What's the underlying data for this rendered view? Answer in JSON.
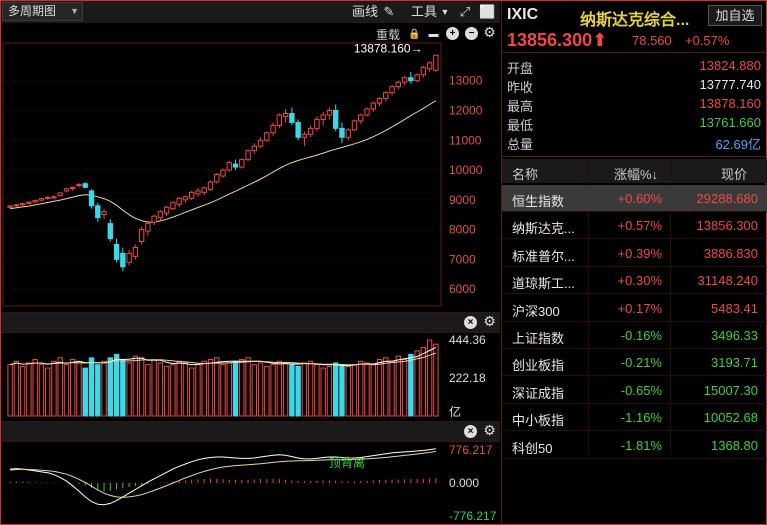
{
  "toolbar": {
    "period_label": "多周期图",
    "draw_label": "画线",
    "tools_label": "工具",
    "reload_label": "重载"
  },
  "chart": {
    "high_annotation": "13878.160",
    "price_axis": [
      "13000",
      "12000",
      "11000",
      "10000",
      "9000",
      "8000",
      "7000",
      "6000"
    ],
    "volume_axis": [
      "444.36",
      "222.18",
      "亿"
    ],
    "macd_axis": [
      "776.217",
      "0.000",
      "-776.217"
    ],
    "macd_annotation": "顶背离"
  },
  "chart_data": {
    "type": "candlestick",
    "price_ylim": [
      5500,
      14200
    ],
    "candles": [
      [
        8750,
        8820,
        8700,
        8790
      ],
      [
        8800,
        8850,
        8760,
        8830
      ],
      [
        8830,
        8900,
        8800,
        8870
      ],
      [
        8880,
        8950,
        8840,
        8920
      ],
      [
        8930,
        9000,
        8900,
        8980
      ],
      [
        8990,
        9060,
        8950,
        9040
      ],
      [
        9050,
        9120,
        9010,
        9080
      ],
      [
        9090,
        9150,
        9030,
        9100
      ],
      [
        9150,
        9250,
        9100,
        9230
      ],
      [
        9300,
        9400,
        9250,
        9370
      ],
      [
        9380,
        9450,
        9300,
        9420
      ],
      [
        9480,
        9560,
        9420,
        9510
      ],
      [
        9540,
        9600,
        9380,
        9420
      ],
      [
        9300,
        9350,
        8700,
        8800
      ],
      [
        8800,
        8900,
        8250,
        8400
      ],
      [
        8500,
        8700,
        8350,
        8600
      ],
      [
        8200,
        8350,
        7600,
        7700
      ],
      [
        7500,
        7700,
        6900,
        7000
      ],
      [
        7200,
        7400,
        6600,
        6750
      ],
      [
        6900,
        7300,
        6800,
        7200
      ],
      [
        7100,
        7500,
        7000,
        7400
      ],
      [
        7600,
        8100,
        7500,
        8000
      ],
      [
        7950,
        8300,
        7800,
        8200
      ],
      [
        8250,
        8500,
        8150,
        8450
      ],
      [
        8400,
        8650,
        8300,
        8600
      ],
      [
        8550,
        8800,
        8450,
        8750
      ],
      [
        8700,
        8950,
        8650,
        8900
      ],
      [
        8850,
        9100,
        8750,
        9050
      ],
      [
        9000,
        9150,
        8900,
        9100
      ],
      [
        9050,
        9300,
        9000,
        9250
      ],
      [
        9200,
        9400,
        9100,
        9300
      ],
      [
        9250,
        9450,
        9150,
        9400
      ],
      [
        9350,
        9650,
        9300,
        9600
      ],
      [
        9600,
        9900,
        9550,
        9850
      ],
      [
        9800,
        10050,
        9750,
        10000
      ],
      [
        10000,
        10300,
        9950,
        10250
      ],
      [
        10200,
        10350,
        10000,
        10100
      ],
      [
        10100,
        10400,
        10050,
        10350
      ],
      [
        10350,
        10700,
        10300,
        10650
      ],
      [
        10650,
        10900,
        10550,
        10800
      ],
      [
        10800,
        11100,
        10750,
        11000
      ],
      [
        11000,
        11300,
        10950,
        11250
      ],
      [
        11250,
        11600,
        11150,
        11500
      ],
      [
        11500,
        11900,
        11400,
        11850
      ],
      [
        11800,
        12050,
        11600,
        11900
      ],
      [
        11900,
        12100,
        11500,
        11600
      ],
      [
        11600,
        11700,
        11000,
        11100
      ],
      [
        11100,
        11300,
        10800,
        11200
      ],
      [
        11200,
        11500,
        11100,
        11400
      ],
      [
        11400,
        11800,
        11300,
        11700
      ],
      [
        11700,
        11950,
        11500,
        11850
      ],
      [
        11850,
        12100,
        11700,
        12000
      ],
      [
        12000,
        12200,
        11300,
        11400
      ],
      [
        11400,
        11600,
        10900,
        11100
      ],
      [
        11100,
        11400,
        11000,
        11350
      ],
      [
        11350,
        11700,
        11300,
        11650
      ],
      [
        11650,
        11900,
        11550,
        11850
      ],
      [
        11850,
        12100,
        11800,
        12050
      ],
      [
        12050,
        12300,
        11950,
        12250
      ],
      [
        12250,
        12450,
        12150,
        12400
      ],
      [
        12400,
        12650,
        12300,
        12600
      ],
      [
        12600,
        12850,
        12500,
        12800
      ],
      [
        12800,
        13000,
        12700,
        12950
      ],
      [
        12950,
        13150,
        12850,
        13100
      ],
      [
        13100,
        13300,
        12900,
        13000
      ],
      [
        13000,
        13250,
        12950,
        13200
      ],
      [
        13200,
        13500,
        13100,
        13450
      ],
      [
        13400,
        13650,
        13300,
        13600
      ],
      [
        13350,
        13880,
        13300,
        13856
      ]
    ],
    "volume_ylim": [
      0,
      450
    ],
    "volume": [
      300,
      320,
      290,
      310,
      330,
      300,
      280,
      320,
      340,
      300,
      330,
      310,
      280,
      340,
      300,
      320,
      340,
      360,
      330,
      310,
      350,
      340,
      300,
      330,
      310,
      290,
      300,
      320,
      310,
      280,
      300,
      320,
      330,
      340,
      300,
      310,
      320,
      330,
      340,
      300,
      310,
      290,
      300,
      320,
      310,
      300,
      290,
      310,
      320,
      300,
      280,
      290,
      310,
      300,
      290,
      300,
      320,
      310,
      300,
      330,
      340,
      320,
      350,
      330,
      360,
      380,
      400,
      444,
      420
    ],
    "volume_up": [
      1,
      1,
      1,
      1,
      1,
      1,
      1,
      1,
      1,
      1,
      1,
      1,
      0,
      0,
      0,
      1,
      0,
      0,
      0,
      1,
      1,
      1,
      1,
      1,
      1,
      1,
      1,
      1,
      1,
      1,
      1,
      1,
      1,
      1,
      1,
      1,
      0,
      1,
      1,
      1,
      1,
      1,
      1,
      1,
      1,
      0,
      0,
      1,
      1,
      1,
      1,
      1,
      0,
      0,
      1,
      1,
      1,
      1,
      1,
      1,
      1,
      1,
      1,
      1,
      0,
      1,
      1,
      1,
      1
    ],
    "macd_ylim": [
      -776.217,
      776.217
    ],
    "macd_hist": [
      80,
      90,
      70,
      60,
      50,
      40,
      30,
      20,
      10,
      0,
      -20,
      -60,
      -150,
      -300,
      -450,
      -520,
      -480,
      -400,
      -320,
      -250,
      -180,
      -120,
      -60,
      -20,
      10,
      40,
      80,
      120,
      160,
      200,
      230,
      250,
      260,
      250,
      230,
      210,
      200,
      190,
      200,
      220,
      240,
      250,
      260,
      240,
      200,
      160,
      130,
      110,
      120,
      140,
      160,
      170,
      150,
      120,
      100,
      110,
      130,
      150,
      170,
      190,
      200,
      210,
      220,
      230,
      240,
      250,
      260,
      280,
      300
    ],
    "macd_dif": [
      300,
      310,
      300,
      280,
      260,
      240,
      220,
      180,
      120,
      40,
      -60,
      -180,
      -300,
      -400,
      -460,
      -470,
      -440,
      -380,
      -300,
      -220,
      -140,
      -60,
      20,
      90,
      160,
      230,
      300,
      360,
      410,
      460,
      500,
      530,
      550,
      560,
      560,
      550,
      540,
      530,
      530,
      540,
      560,
      580,
      600,
      610,
      600,
      570,
      540,
      520,
      520,
      530,
      550,
      560,
      560,
      550,
      540,
      540,
      550,
      570,
      590,
      610,
      630,
      650,
      660,
      670,
      680,
      690,
      700,
      720,
      740
    ],
    "macd_dea": [
      280,
      290,
      295,
      292,
      285,
      275,
      265,
      250,
      225,
      190,
      140,
      80,
      10,
      -70,
      -150,
      -220,
      -270,
      -300,
      -310,
      -300,
      -280,
      -250,
      -210,
      -160,
      -110,
      -55,
      0,
      55,
      110,
      160,
      210,
      250,
      290,
      320,
      345,
      360,
      375,
      385,
      395,
      405,
      415,
      430,
      445,
      460,
      470,
      475,
      480,
      480,
      485,
      490,
      495,
      500,
      505,
      505,
      505,
      510,
      515,
      520,
      530,
      540,
      550,
      565,
      580,
      595,
      610,
      625,
      640,
      660,
      680
    ],
    "ma_line": [
      8700,
      8730,
      8760,
      8790,
      8830,
      8870,
      8910,
      8950,
      8990,
      9040,
      9090,
      9140,
      9170,
      9150,
      9100,
      9040,
      8950,
      8820,
      8650,
      8500,
      8380,
      8300,
      8250,
      8250,
      8290,
      8350,
      8420,
      8500,
      8580,
      8660,
      8740,
      8820,
      8900,
      8990,
      9090,
      9190,
      9290,
      9390,
      9490,
      9590,
      9700,
      9810,
      9930,
      10050,
      10160,
      10250,
      10320,
      10380,
      10440,
      10500,
      10570,
      10640,
      10700,
      10760,
      10820,
      10880,
      10950,
      11030,
      11120,
      11220,
      11330,
      11450,
      11570,
      11700,
      11830,
      11950,
      12070,
      12200,
      12330
    ]
  },
  "quote": {
    "symbol": "IXIC",
    "name": "纳斯达克综合...",
    "add_label": "加自选",
    "price": "13856.300",
    "change": "78.560",
    "change_pct": "+0.57%",
    "stats": [
      {
        "k": "开盘",
        "v": "13824.880",
        "color": "#f04848"
      },
      {
        "k": "昨收",
        "v": "13777.740",
        "color": "#e8e8e8"
      },
      {
        "k": "最高",
        "v": "13878.160",
        "color": "#f04848"
      },
      {
        "k": "最低",
        "v": "13761.660",
        "color": "#3cd23c"
      },
      {
        "k": "总量",
        "v": "62.69亿",
        "color": "#4aa8ff"
      }
    ]
  },
  "list": {
    "headers": [
      "名称",
      "涨幅%↓",
      "现价"
    ],
    "rows": [
      {
        "name": "恒生指数",
        "pct": "+0.60%",
        "price": "29288.680",
        "up": true
      },
      {
        "name": "纳斯达克...",
        "pct": "+0.57%",
        "price": "13856.300",
        "up": true
      },
      {
        "name": "标准普尔...",
        "pct": "+0.39%",
        "price": "3886.830",
        "up": true
      },
      {
        "name": "道琼斯工...",
        "pct": "+0.30%",
        "price": "31148.240",
        "up": true
      },
      {
        "name": "沪深300",
        "pct": "+0.17%",
        "price": "5483.41",
        "up": true
      },
      {
        "name": "上证指数",
        "pct": "-0.16%",
        "price": "3496.33",
        "up": false
      },
      {
        "name": "创业板指",
        "pct": "-0.21%",
        "price": "3193.71",
        "up": false
      },
      {
        "name": "深证成指",
        "pct": "-0.65%",
        "price": "15007.30",
        "up": false
      },
      {
        "name": "中小板指",
        "pct": "-1.16%",
        "price": "10052.68",
        "up": false
      },
      {
        "name": "科创50",
        "pct": "-1.81%",
        "price": "1368.80",
        "up": false
      }
    ]
  },
  "colors": {
    "up": "#f04848",
    "down": "#3cd23c",
    "cyan": "#3cd8e8",
    "accent": "#c83232"
  }
}
